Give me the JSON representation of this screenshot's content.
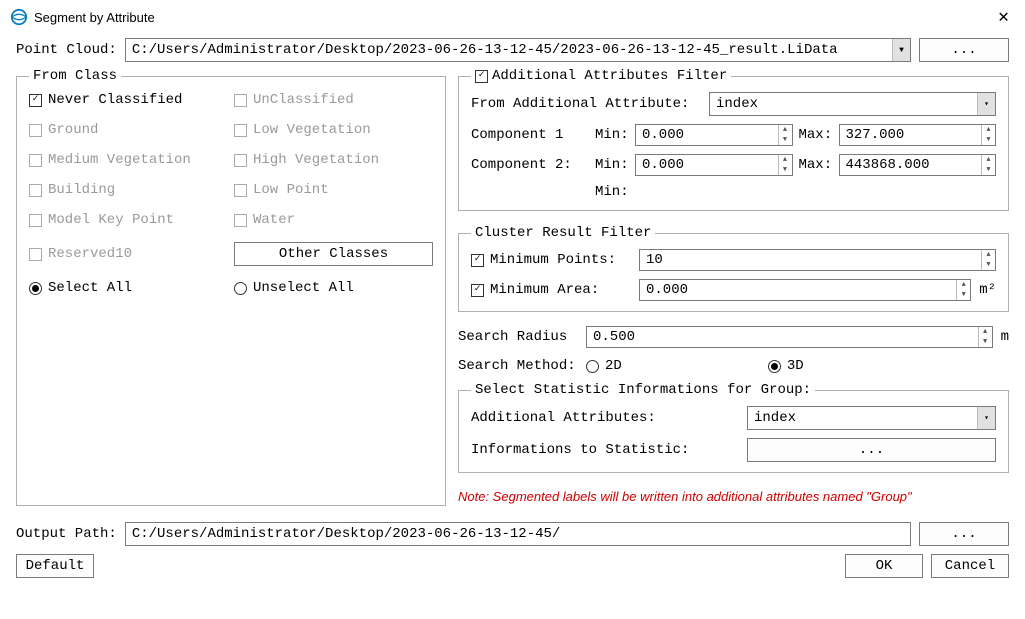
{
  "title": "Segment by Attribute",
  "pointcloud": {
    "label": "Point Cloud:",
    "path": "C:/Users/Administrator/Desktop/2023-06-26-13-12-45/2023-06-26-13-12-45_result.LiData",
    "browse": "..."
  },
  "fromclass": {
    "legend": "From Class",
    "items": {
      "never": "Never Classified",
      "unclassified": "UnClassified",
      "ground": "Ground",
      "lowveg": "Low Vegetation",
      "medveg": "Medium Vegetation",
      "highveg": "High Vegetation",
      "building": "Building",
      "lowpoint": "Low Point",
      "modelkey": "Model Key Point",
      "water": "Water",
      "reserved10": "Reserved10"
    },
    "other": "Other Classes",
    "select_all": "Select All",
    "unselect_all": "Unselect All"
  },
  "addfilter": {
    "legend": "Additional Attributes Filter",
    "from_label": "From Additional Attribute:",
    "from_value": "index",
    "comp1": "Component 1",
    "comp2": "Component 2:",
    "min_lbl": "Min:",
    "max_lbl": "Max:",
    "c1_min": "0.000",
    "c1_max": "327.000",
    "c2_min": "0.000",
    "c2_max": "443868.000",
    "extra_min": "Min:"
  },
  "cluster": {
    "legend": "Cluster Result Filter",
    "minpts_lbl": "Minimum Points:",
    "minpts_val": "10",
    "minarea_lbl": "Minimum Area:",
    "minarea_val": "0.000",
    "unit": "m²"
  },
  "search": {
    "radius_lbl": "Search Radius",
    "radius_val": "0.500",
    "unit": "m",
    "method_lbl": "Search Method:",
    "opt2d": "2D",
    "opt3d": "3D"
  },
  "stats": {
    "legend": "Select Statistic Informations for Group:",
    "addattr_lbl": "Additional Attributes:",
    "addattr_val": "index",
    "info_lbl": "Informations to Statistic:",
    "info_val": "..."
  },
  "note": "Note: Segmented labels will be written into additional attributes named \"Group\"",
  "output": {
    "label": "Output Path:",
    "path": "C:/Users/Administrator/Desktop/2023-06-26-13-12-45/",
    "browse": "..."
  },
  "buttons": {
    "default": "Default",
    "ok": "OK",
    "cancel": "Cancel"
  }
}
